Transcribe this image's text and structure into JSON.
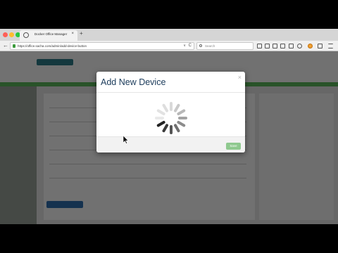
{
  "browser": {
    "tab_title": "Docker Office Manager",
    "tab_close": "×",
    "new_tab": "+",
    "back": "←",
    "forward": "→",
    "url": "https://office.sacha.com/admin/add-device-button",
    "reload": "C",
    "dropdown": "∨",
    "search_placeholder": "Search"
  },
  "modal": {
    "title": "Add New Device",
    "close": "×",
    "save_label": "Save"
  },
  "colors": {
    "accent_green": "#5cb85c",
    "save_button": "#8fc98f",
    "modal_title": "#1a3a5a"
  },
  "icons": [
    "lock-icon",
    "search-icon",
    "loading-spinner-icon",
    "mouse-cursor-icon"
  ]
}
